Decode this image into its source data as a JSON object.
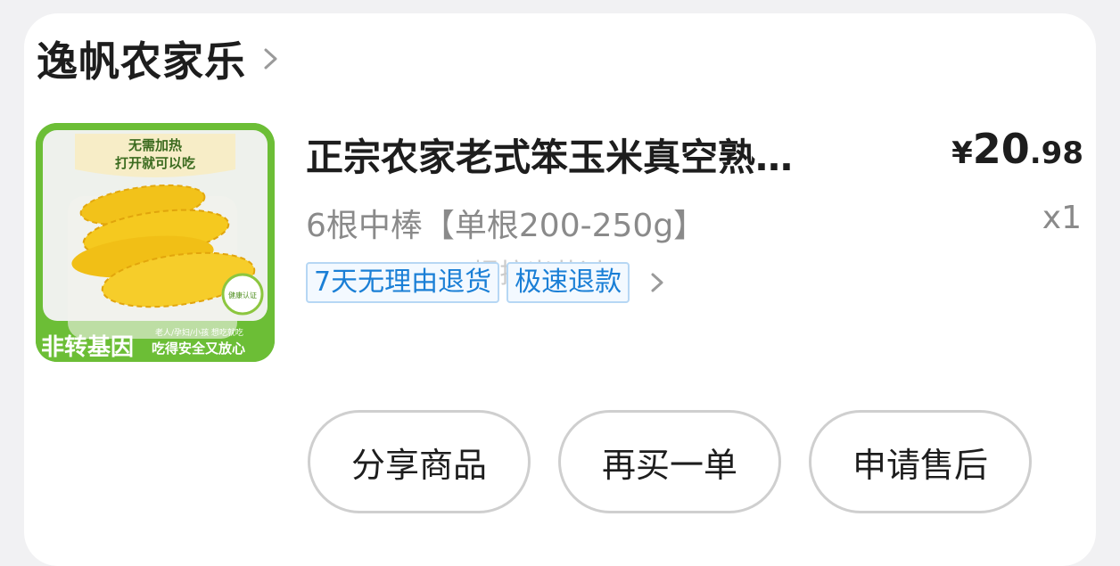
{
  "shop": {
    "name": "逸帆农家乐"
  },
  "product": {
    "title": "正宗农家老式笨玉米真空熟…",
    "price_symbol": "¥",
    "price_integer": "20",
    "price_decimal": ".98",
    "spec": "6根中棒【单根200-250g】",
    "quantity": "x1",
    "tags": [
      "7天无理由退货",
      "极速退款"
    ],
    "image": {
      "banner_line1": "无需加热",
      "banner_line2": "打开就可以吃",
      "badge": "健康认证",
      "bottom_left": "非转基因",
      "bottom_small": "老人/孕妇/小孩  想吃就吃",
      "bottom_right": "吃得安全又放心"
    }
  },
  "watermark": "@提拉米苏过",
  "actions": {
    "share": "分享商品",
    "rebuy": "再买一单",
    "after_sale": "申请售后"
  },
  "colors": {
    "tag_text": "#1a7fd6",
    "tag_border": "#b6d7f4",
    "image_green": "#6cbe36"
  }
}
